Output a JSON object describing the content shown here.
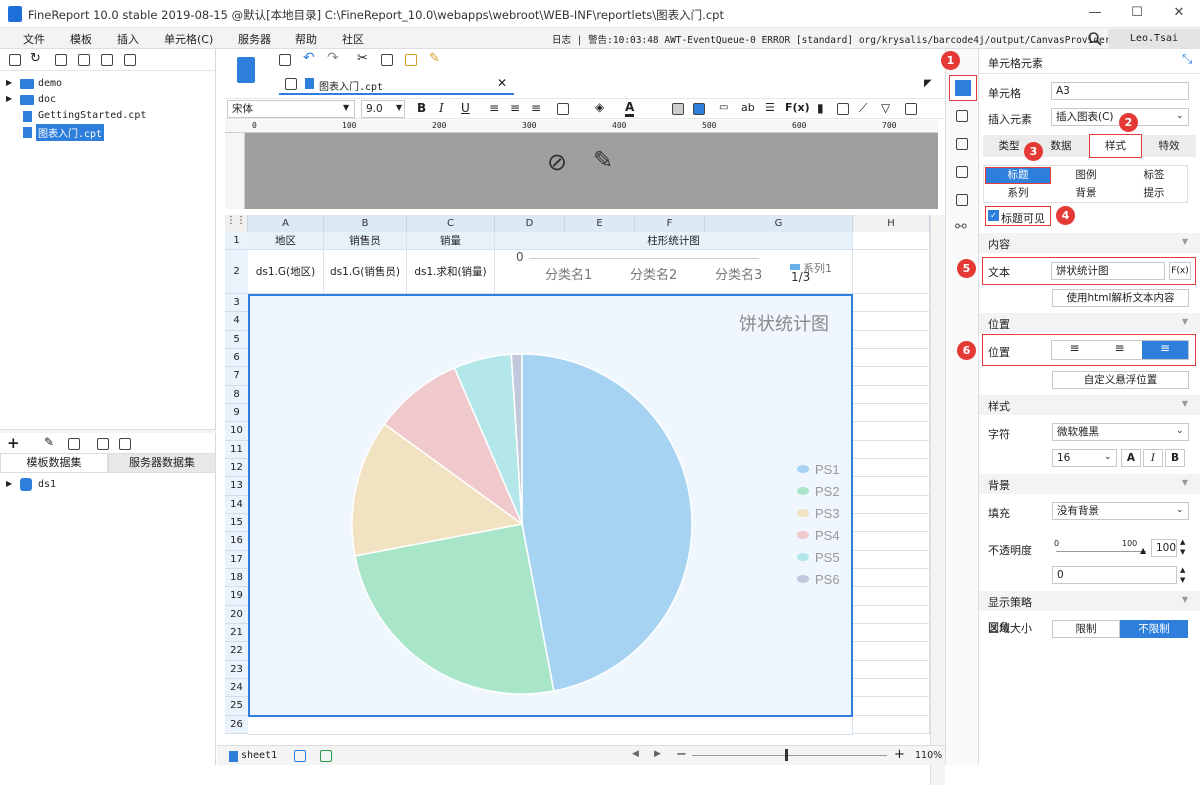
{
  "window": {
    "title": "FineReport 10.0 stable 2019-08-15 @默认[本地目录]   C:\\FineReport_10.0\\webapps\\webroot\\WEB-INF\\reportlets\\图表入门.cpt"
  },
  "menu": [
    "文件",
    "模板",
    "插入",
    "单元格(C)",
    "服务器",
    "帮助",
    "社区"
  ],
  "status": "日志 | 警告:10:03:48 AWT-EventQueue-0 ERROR [standard] org/krysalis/barcode4j/output/CanvasProvider",
  "user": "Leo.Tsai",
  "tree": {
    "items": [
      "demo",
      "doc",
      "GettingStarted.cpt",
      "图表入门.cpt"
    ],
    "selected": "图表入门.cpt"
  },
  "datasets": {
    "tabs": [
      "模板数据集",
      "服务器数据集"
    ],
    "items": [
      "ds1"
    ]
  },
  "editor": {
    "tab": "图表入门.cpt",
    "font": "宋体",
    "size": "9.0",
    "ruler": [
      "0",
      "100",
      "200",
      "300",
      "400",
      "500",
      "600",
      "700"
    ],
    "cols": [
      "A",
      "B",
      "C",
      "D",
      "E",
      "F",
      "G",
      "H"
    ],
    "rows": [
      "1",
      "2",
      "3",
      "4",
      "5",
      "6",
      "7",
      "8",
      "9",
      "10",
      "11",
      "12",
      "13",
      "14",
      "15",
      "16",
      "17",
      "18",
      "19",
      "20",
      "21",
      "22",
      "23",
      "24",
      "25",
      "26"
    ],
    "row1": [
      "地区",
      "销售员",
      "销量",
      "柱形统计图"
    ],
    "row2": [
      "ds1.G(地区)",
      "ds1.G(销售员)",
      "ds1.求和(销量)"
    ],
    "bar_preview": {
      "zero": "0",
      "cats": [
        "分类名1",
        "分类名2",
        "分类名3"
      ],
      "legend": "系列1",
      "page": "1/3"
    },
    "sheet": "sheet1",
    "zoom": "110%"
  },
  "chart_data": {
    "type": "pie",
    "title": "饼状统计图",
    "legend_position": "right",
    "series": [
      {
        "name": "PS1",
        "value": 47,
        "color": "#a7d3f3"
      },
      {
        "name": "PS2",
        "value": 25,
        "color": "#a9e6c9"
      },
      {
        "name": "PS3",
        "value": 13,
        "color": "#f1e3c2"
      },
      {
        "name": "PS4",
        "value": 8.5,
        "color": "#efc9cb"
      },
      {
        "name": "PS5",
        "value": 5.5,
        "color": "#b3e7ea"
      },
      {
        "name": "PS6",
        "value": 1,
        "color": "#c2c8dc"
      }
    ]
  },
  "props": {
    "header": "单元格元素",
    "cell_label": "单元格",
    "cell_value": "A3",
    "insert_label": "插入元素",
    "insert_value": "插入图表(C)",
    "tabs": [
      "类型",
      "数据",
      "样式",
      "特效"
    ],
    "subtabs": [
      "标题",
      "图例",
      "标签",
      "系列",
      "背景",
      "提示"
    ],
    "title_visible": "标题可见",
    "content": "内容",
    "text_label": "文本",
    "text_value": "饼状统计图",
    "fx": "F(x)",
    "html_btn": "使用html解析文本内容",
    "position_section": "位置",
    "position_label": "位置",
    "custom_float": "自定义悬浮位置",
    "style_section": "样式",
    "font_label": "字符",
    "font_value": "微软雅黑",
    "font_size": "16",
    "bg_section": "背景",
    "fill_label": "填充",
    "fill_value": "没有背景",
    "opacity_label": "不透明度",
    "opacity_min": "0",
    "opacity_max": "100",
    "opacity_value": "100",
    "radius_label": "圆角",
    "radius_value": "0",
    "display_section": "显示策略",
    "area_label": "区域大小",
    "limit": "限制",
    "nolimit": "不限制"
  },
  "badges": [
    "1",
    "2",
    "3",
    "4",
    "5",
    "6"
  ]
}
